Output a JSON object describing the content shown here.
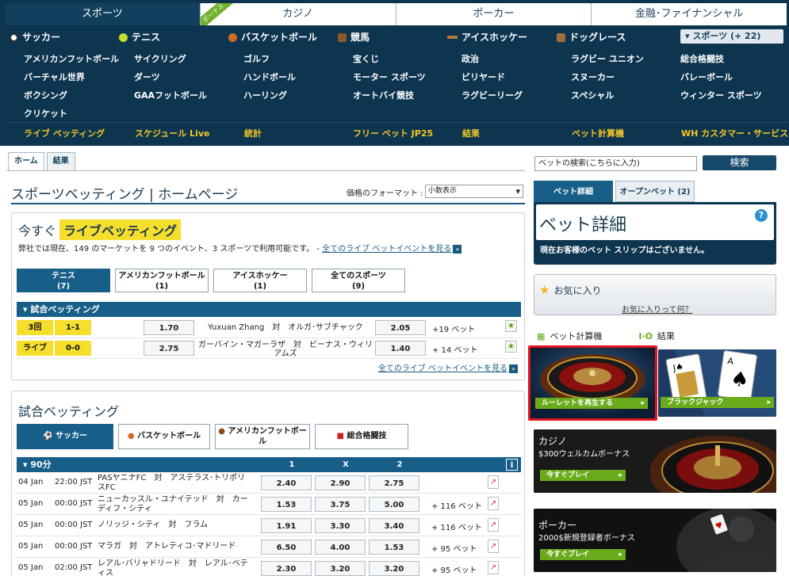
{
  "nav": {
    "top_tabs": [
      {
        "label": "スポーツ",
        "active": true
      },
      {
        "label": "カジノ",
        "badge": "ボーナス"
      },
      {
        "label": "ポーカー"
      },
      {
        "label": "金融･ファイナンシャル"
      }
    ],
    "sports": [
      {
        "label": "サッカー",
        "icon": "soccer-ball-icon"
      },
      {
        "label": "テニス",
        "icon": "tennis-ball-icon"
      },
      {
        "label": "バスケットボール",
        "icon": "basketball-icon"
      },
      {
        "label": "競馬",
        "icon": "horse-icon"
      },
      {
        "label": "アイスホッケー",
        "icon": "hockey-stick-icon"
      },
      {
        "label": "ドッグレース",
        "icon": "dog-icon"
      }
    ],
    "more_sports": "▾ スポーツ (+ 22)",
    "sublinks": [
      [
        "アメリカンフットボール",
        "サイクリング",
        "ゴルフ",
        "宝くじ",
        "政治",
        "ラグビー ユニオン",
        "総合格闘技"
      ],
      [
        "バーチャル世界",
        "ダーツ",
        "ハンドボール",
        "モーター スポーツ",
        "ビリヤード",
        "スヌーカー",
        "バレーボール"
      ],
      [
        "ボクシング",
        "GAAフットボール",
        "ハーリング",
        "オートバイ競技",
        "ラグビーリーグ",
        "スペシャル",
        "ウィンター スポーツ"
      ],
      [
        "クリケット"
      ]
    ],
    "quick_links": [
      "ライブ ベッティング",
      "スケジュール Live",
      "統計",
      "フリー ベット JP25",
      "結果",
      "ベット計算機",
      "WH カスタマー・サービス"
    ]
  },
  "left": {
    "tabs": [
      "ホーム",
      "結果"
    ],
    "page_title": "スポーツベッティング | ホームページ",
    "price_format_label": "価格のフォーマット :",
    "price_format_value": "小数表示",
    "live": {
      "title_prefix": "今すぐ",
      "title_highlight": "ライブベッティング",
      "desc": "弊社では現在、149 のマーケットを 9 つのイベント、3 スポーツで利用可能です。 - ",
      "desc_link": "全てのライブ ベットイベントを見る",
      "sport_tabs": [
        {
          "label": "テニス",
          "count": "(7)",
          "active": true
        },
        {
          "label": "アメリカンフットボール",
          "count": "(1)"
        },
        {
          "label": "アイスホッケー",
          "count": "(1)"
        },
        {
          "label": "全てのスポーツ",
          "count": "(9)"
        }
      ],
      "section": "試合ベッティング",
      "rows": [
        {
          "status": "3回",
          "score": "1-1",
          "odd1": "1.70",
          "event": "Yuxuan Zhang　対　オルガ･サブチャック",
          "odd2": "2.05",
          "markets": "+19 ベット"
        },
        {
          "status": "ライブ",
          "score": "0-0",
          "odd1": "2.75",
          "event": "ガーバイン・マガーラザ　対　ビーナス・ウィリアムズ",
          "odd2": "1.40",
          "markets": "+ 14 ベット"
        }
      ],
      "all_link": "全てのライブ ベットイベントを見る"
    },
    "match": {
      "title": "試合ベッティング",
      "sport_tabs": [
        {
          "label": "サッカー",
          "active": true
        },
        {
          "label": "バスケットボール"
        },
        {
          "label": "アメリカンフットボール"
        },
        {
          "label": "総合格闘技"
        }
      ],
      "section": "90分",
      "headers": [
        "1",
        "X",
        "2"
      ],
      "info": "i",
      "rows": [
        {
          "date": "04 Jan",
          "time": "22:00 JST",
          "name": "PASヤニナFC　対　アステラス･トリポリスFC",
          "o1": "2.40",
          "ox": "2.90",
          "o2": "2.75",
          "markets": ""
        },
        {
          "date": "05 Jan",
          "time": "00:00 JST",
          "name": "ニューカッスル・ユナイテッド　対　カーディフ・シティ",
          "o1": "1.53",
          "ox": "3.75",
          "o2": "5.00",
          "markets": "+ 116 ベット"
        },
        {
          "date": "05 Jan",
          "time": "00:00 JST",
          "name": "ノリッジ・シティ　対　フラム",
          "o1": "1.91",
          "ox": "3.30",
          "o2": "3.40",
          "markets": "+ 116 ベット"
        },
        {
          "date": "05 Jan",
          "time": "00:00 JST",
          "name": "マラガ　対　アトレティコ･マドリード",
          "o1": "6.50",
          "ox": "4.00",
          "o2": "1.53",
          "markets": "+ 95 ベット"
        },
        {
          "date": "05 Jan",
          "time": "02:00 JST",
          "name": "レアル･バリャドリード　対　レアル･ベティス",
          "o1": "2.30",
          "ox": "3.20",
          "o2": "3.20",
          "markets": "+ 95 ベット"
        }
      ]
    }
  },
  "right": {
    "search_placeholder": "ベットの検索(こちらに入力)",
    "search_button": "検索",
    "tabs": [
      "ベット詳細",
      "オープンベット (2)"
    ],
    "bet_title": "ベット詳細",
    "bet_msg": "現在お客様のベット スリップはございません。",
    "fav_title": "お気に入り",
    "fav_link": "お気に入りって何？",
    "tools": [
      "ベット計算機",
      "結果"
    ],
    "roulette_btn": "ルーレットを再生する",
    "blackjack_btn": "ブラックジャック",
    "casino_title": "カジノ",
    "casino_sub": "$300ウェルカムボーナス",
    "casino_btn": "今すぐプレイ",
    "poker_title": "ポーカー",
    "poker_sub": "2000$新規登録者ボーナス",
    "poker_btn": "今すぐプレイ",
    "highlight_color": "#e0141e",
    "accent_yellow": "#f6df2c",
    "header_blue": "#0d3550"
  }
}
